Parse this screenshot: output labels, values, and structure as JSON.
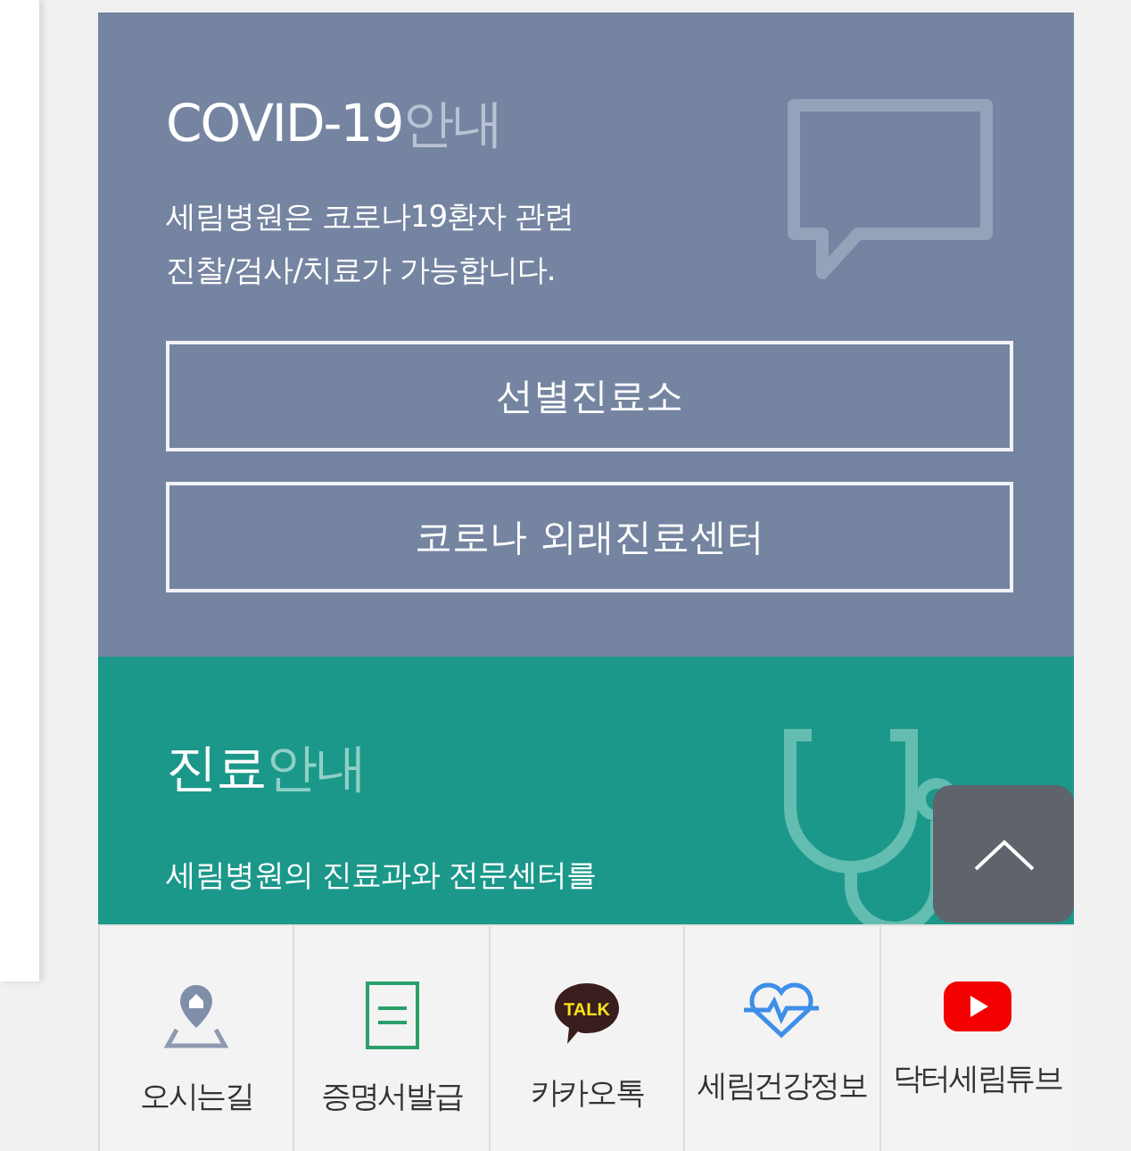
{
  "covid": {
    "title": "COVID-19",
    "title_suffix": "안내",
    "lines": [
      "세림병원은 코로나19환자 관련",
      "진찰/검사/치료가 가능합니다."
    ],
    "buttons": [
      "선별진료소",
      "코로나 외래진료센터"
    ]
  },
  "treatment": {
    "title": "진료",
    "title_suffix": "안내",
    "lines": [
      "세림병원의 진료과와 전문센터를"
    ]
  },
  "bottom_nav": [
    {
      "kind": "map",
      "label": "오시는길"
    },
    {
      "kind": "document",
      "label": "증명서발급"
    },
    {
      "kind": "talk",
      "label": "카카오톡",
      "icon_text": "TALK"
    },
    {
      "kind": "heart",
      "label": "세림건강정보"
    },
    {
      "kind": "video",
      "label": "닥터세림튜브"
    }
  ]
}
